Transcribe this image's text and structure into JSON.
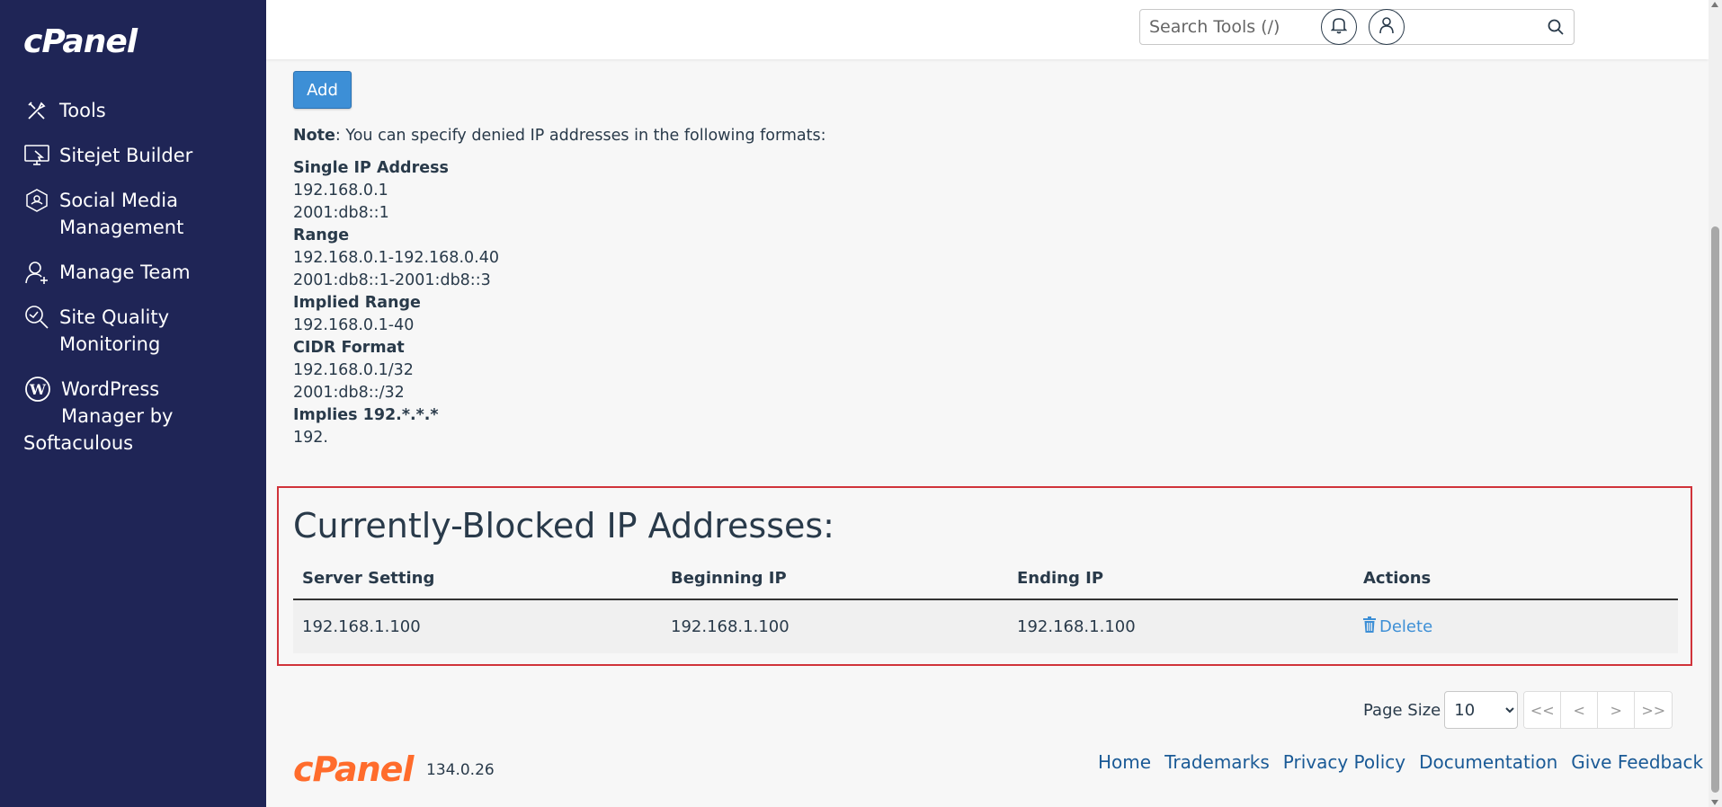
{
  "sidebar": {
    "logo": "cPanel",
    "items": [
      {
        "label": "Tools",
        "icon": "tools-icon"
      },
      {
        "label": "Sitejet Builder",
        "icon": "sitejet-icon"
      },
      {
        "label": "Social Media Management",
        "icon": "social-media-icon"
      },
      {
        "label": "Manage Team",
        "icon": "manage-team-icon"
      },
      {
        "label": "Site Quality Monitoring",
        "icon": "site-quality-icon"
      },
      {
        "label_line1": "WordPress",
        "label_line2": "Manager by",
        "label_line3": "Softaculous",
        "icon": "wordpress-icon"
      }
    ]
  },
  "topbar": {
    "search_placeholder": "Search Tools (/)"
  },
  "main": {
    "add_label": "Add",
    "note_label": "Note",
    "note_text": ": You can specify denied IP addresses in the following formats:",
    "formats": [
      {
        "heading": "Single IP Address",
        "lines": [
          "192.168.0.1",
          "2001:db8::1"
        ]
      },
      {
        "heading": "Range",
        "lines": [
          "192.168.0.1-192.168.0.40",
          "2001:db8::1-2001:db8::3"
        ]
      },
      {
        "heading": "Implied Range",
        "lines": [
          "192.168.0.1-40"
        ]
      },
      {
        "heading": "CIDR Format",
        "lines": [
          "192.168.0.1/32",
          "2001:db8::/32"
        ]
      },
      {
        "heading": "Implies 192.*.*.*",
        "lines": [
          "192."
        ]
      }
    ]
  },
  "blocked": {
    "title": "Currently-Blocked IP Addresses:",
    "columns": [
      "Server Setting",
      "Beginning IP",
      "Ending IP",
      "Actions"
    ],
    "rows": [
      {
        "server_setting": "192.168.1.100",
        "beginning_ip": "192.168.1.100",
        "ending_ip": "192.168.1.100",
        "action": "Delete"
      }
    ]
  },
  "pager": {
    "label": "Page Size",
    "selected": "10",
    "buttons": [
      "<<",
      "<",
      ">",
      ">>"
    ]
  },
  "footer": {
    "logo": "cPanel",
    "version": "134.0.26",
    "links": [
      "Home",
      "Trademarks",
      "Privacy Policy",
      "Documentation",
      "Give Feedback"
    ]
  },
  "colors": {
    "sidebar_bg": "#1f2556",
    "accent": "#3d8fd6",
    "highlight_border": "#d0333a",
    "footer_logo": "#ff6c2c"
  }
}
